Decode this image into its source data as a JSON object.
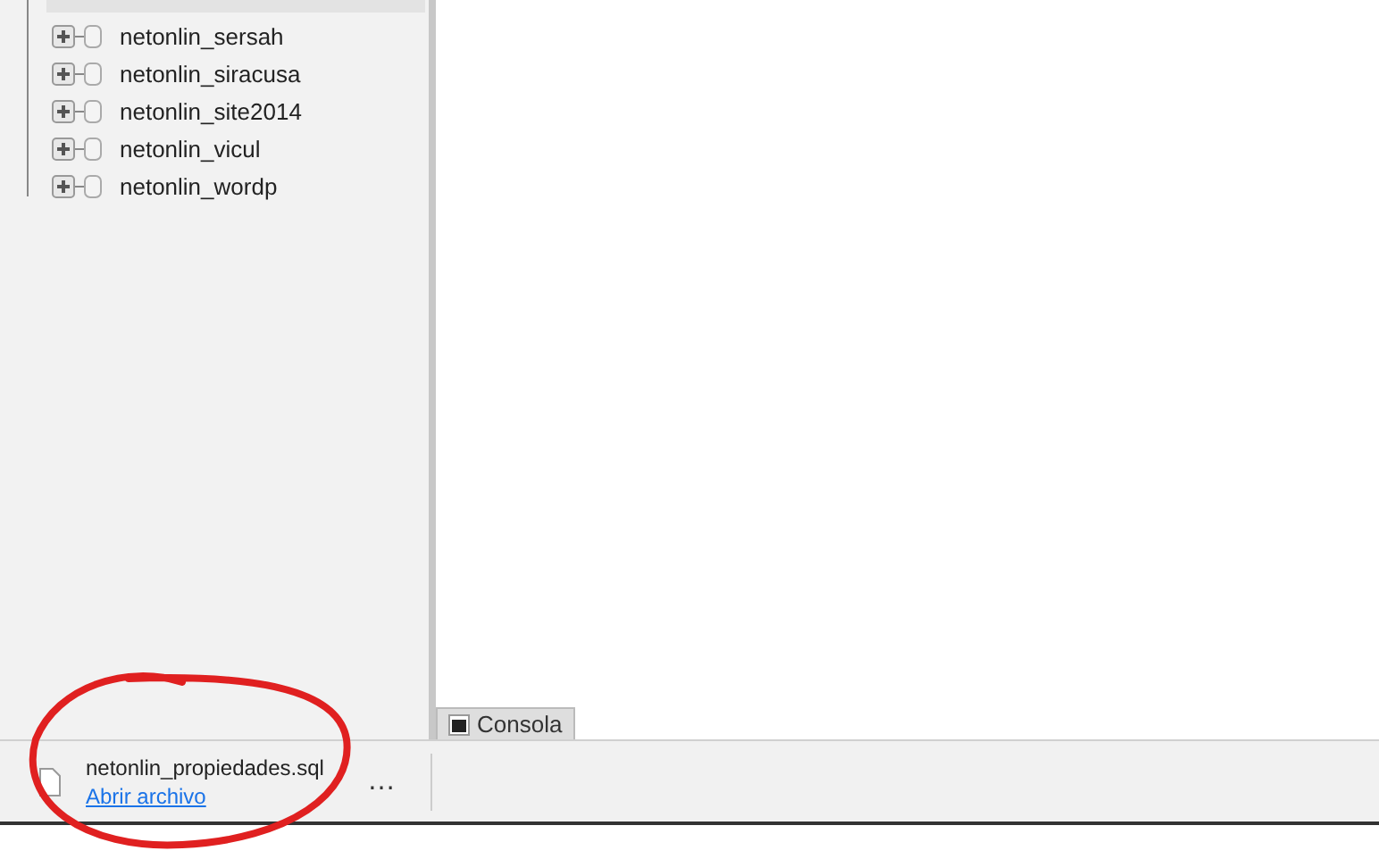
{
  "tree": {
    "items": [
      {
        "label": "netonlin_sersah",
        "expanded": false
      },
      {
        "label": "netonlin_siracusa",
        "expanded": false
      },
      {
        "label": "netonlin_site2014",
        "expanded": false
      },
      {
        "label": "netonlin_vicul",
        "expanded": false
      },
      {
        "label": "netonlin_wordp",
        "expanded": false
      }
    ]
  },
  "console_tab": {
    "label": "Consola"
  },
  "download_bar": {
    "file_name": "netonlin_propiedades.sql",
    "link": "Abrir archivo",
    "more": "…"
  }
}
